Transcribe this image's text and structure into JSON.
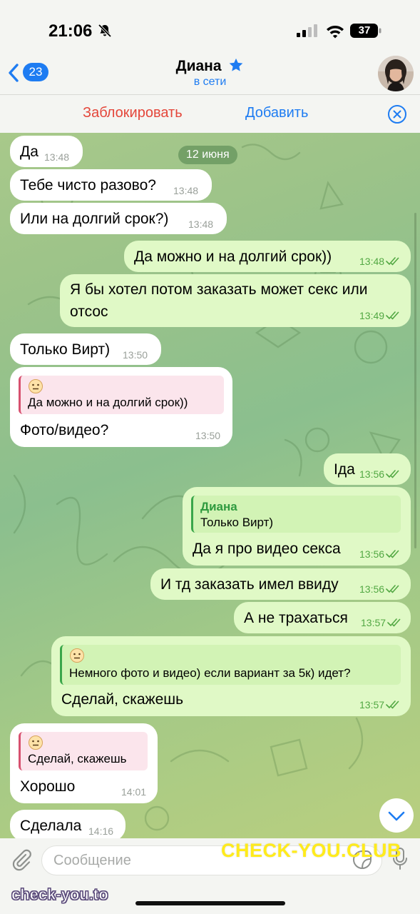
{
  "status_bar": {
    "time": "21:06",
    "battery": "37"
  },
  "header": {
    "back_count": "23",
    "contact_name": "Диана",
    "status": "в сети"
  },
  "actions": {
    "block": "Заблокировать",
    "add": "Добавить"
  },
  "chat": {
    "date_separator": "12 июня",
    "messages": [
      {
        "dir": "in",
        "text": "Да",
        "time": "13:48"
      },
      {
        "dir": "in",
        "text": "Тебе чисто разово?",
        "time": "13:48"
      },
      {
        "dir": "in",
        "text": "Или на долгий срок?)",
        "time": "13:48"
      },
      {
        "dir": "out",
        "text": "Да можно и на долгий срок))",
        "time": "13:48"
      },
      {
        "dir": "out",
        "text_line1": "Я бы хотел потом заказать может секс или",
        "text_line2": "отсос",
        "time": "13:49"
      },
      {
        "dir": "in",
        "text": "Только Вирт)",
        "time": "13:50"
      },
      {
        "dir": "in",
        "reply_text": "Да можно и на долгий срок))",
        "text": "Фото/видео?",
        "time": "13:50"
      },
      {
        "dir": "out",
        "text": "Іда",
        "time": "13:56"
      },
      {
        "dir": "out",
        "reply_name": "Диана",
        "reply_text": "Только Вирт)",
        "text": "Да я про видео секса",
        "time": "13:56"
      },
      {
        "dir": "out",
        "text": "И тд заказать имел ввиду",
        "time": "13:56"
      },
      {
        "dir": "out",
        "text": "А не трахаться",
        "time": "13:57"
      },
      {
        "dir": "out",
        "reply_text": "Немного фото и видео) если вариант за 5к) идет?",
        "text": "Сделай, скажешь",
        "time": "13:57"
      },
      {
        "dir": "in",
        "reply_text": "Сделай, скажешь",
        "text": "Хорошо",
        "time": "14:01"
      },
      {
        "dir": "in",
        "text": "Сделала",
        "time": "14:16"
      }
    ]
  },
  "input": {
    "placeholder": "Сообщение"
  },
  "watermarks": {
    "top": "CHECK-YOU.CLUB",
    "bottom": "check-you.to"
  },
  "colors": {
    "accent": "#1e7cf2",
    "danger": "#e4463a",
    "outgoing_bubble": "#e0f9c6",
    "incoming_bubble": "#ffffff"
  }
}
